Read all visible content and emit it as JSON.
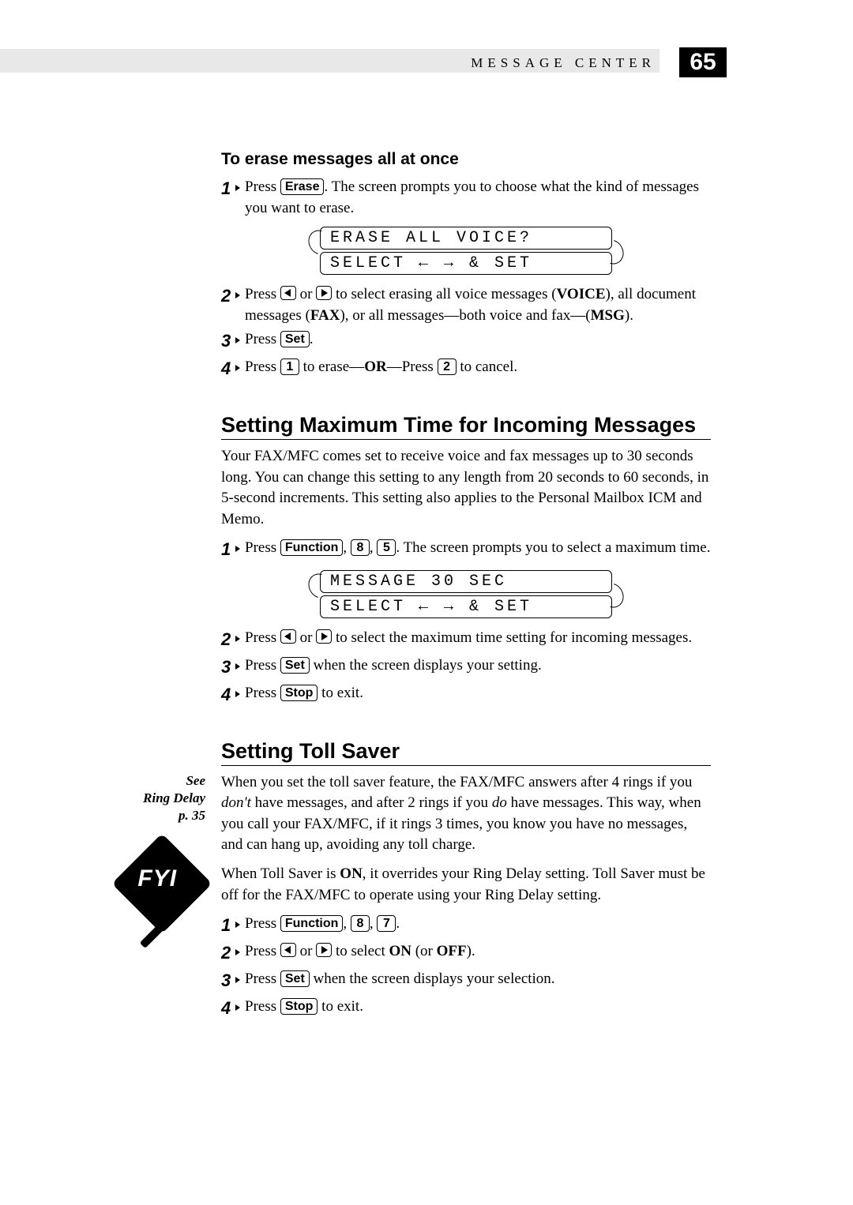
{
  "header": {
    "section": "MESSAGE CENTER",
    "page": "65"
  },
  "erase": {
    "title": "To erase messages all at once",
    "step1a": "Press ",
    "key_erase": "Erase",
    "step1b": ".   The screen prompts you to choose what the kind of messages you want to erase.",
    "lcd1": "ERASE ALL VOICE?",
    "lcd2": "SELECT ← → & SET",
    "step2a": "Press ",
    "step2b": " or ",
    "step2c": " to select erasing all voice messages (",
    "voice": "VOICE",
    "step2d": "), all document messages (",
    "fax": "FAX",
    "step2e": "), or all messages—both voice and fax—(",
    "msg": "MSG",
    "step2f": ").",
    "step3a": "Press ",
    "key_set": "Set",
    "step3b": ".",
    "step4a": "Press ",
    "key_1": "1",
    "step4b": " to erase—",
    "or": "OR",
    "step4c": "—Press ",
    "key_2": "2",
    "step4d": " to cancel."
  },
  "maxtime": {
    "title": "Setting Maximum Time for Incoming Messages",
    "para": "Your FAX/MFC comes set to receive voice and fax messages up to 30 seconds long. You can change this setting to any length from 20 seconds to 60 seconds, in 5-second increments.  This setting also applies to the Personal Mailbox ICM and Memo.",
    "step1a": "Press ",
    "key_function": "Function",
    "comma": ", ",
    "key_8": "8",
    "key_5": "5",
    "step1b": ".   The screen prompts you to select a maximum time.",
    "lcd1": "MESSAGE 30 SEC",
    "lcd2": "SELECT ← → & SET",
    "step2a": "Press ",
    "step2b": " or ",
    "step2c": " to select the maximum time setting for incoming messages.",
    "step3a": "Press ",
    "key_set": "Set",
    "step3b": " when the screen displays your setting.",
    "step4a": "Press ",
    "key_stop": "Stop",
    "step4b": " to exit."
  },
  "toll": {
    "title": "Setting Toll Saver",
    "sidenote": "See\nRing Delay\np. 35",
    "fyi": "FYI",
    "para1a": "When you set the toll saver feature, the FAX/MFC answers after 4 rings if you ",
    "dont": "don't",
    "para1b": " have messages, and after 2 rings if you ",
    "do": "do",
    "para1c": " have messages.  This way, when you call your FAX/MFC, if it rings 3 times, you know you have no messages, and can hang up, avoiding any toll charge.",
    "para2a": "When Toll Saver is ",
    "on": "ON",
    "para2b": ", it overrides your Ring Delay setting. Toll Saver must be off for the FAX/MFC to operate using your Ring Delay setting.",
    "step1a": "Press ",
    "key_function": "Function",
    "comma": ", ",
    "key_8": "8",
    "key_7": "7",
    "period": ".",
    "step2a": "Press ",
    "step2b": " or ",
    "step2c": " to select ",
    "on2": "ON",
    "step2d": " (or ",
    "off": "OFF",
    "step2e": ").",
    "step3a": "Press ",
    "key_set": "Set",
    "step3b": " when the screen displays your selection.",
    "step4a": "Press ",
    "key_stop": "Stop",
    "step4b": " to exit."
  }
}
